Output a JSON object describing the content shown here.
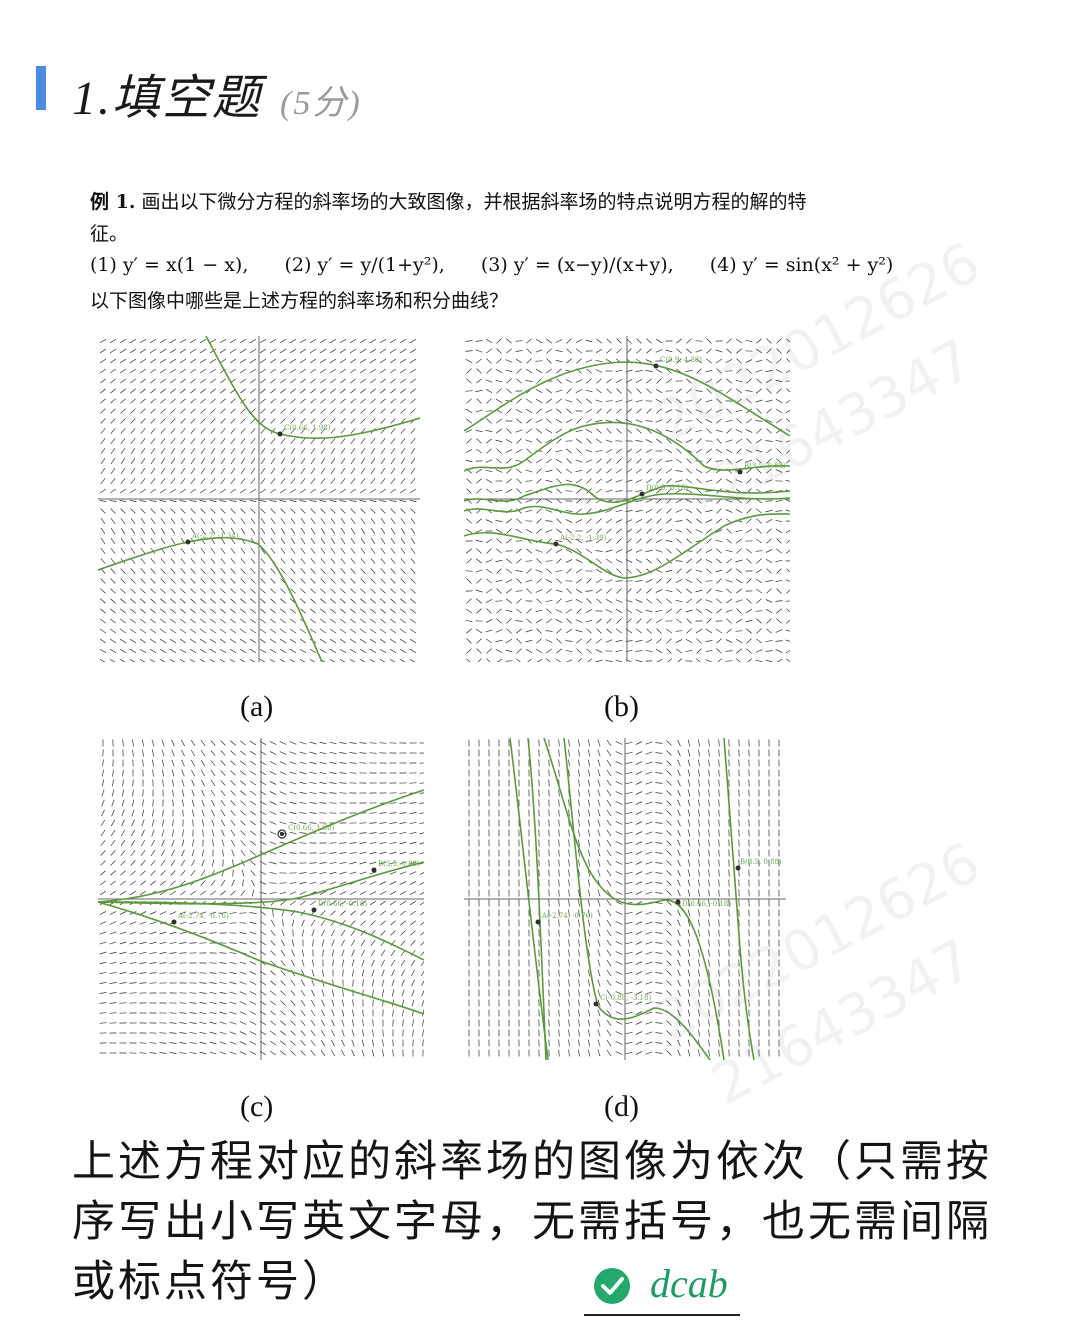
{
  "header": {
    "title": "1.填空题",
    "score": "(5分)"
  },
  "problem": {
    "label": "例 1.",
    "text": "画出以下微分方程的斜率场的大致图像，并根据斜率场的特点说明方程的解的特征。",
    "equations": [
      "(1) y′ = x(1 − x),",
      "(2) y′ = y/(1+y²),",
      "(3) y′ = (x−y)/(x+y),",
      "(4) y′ = sin(x² + y²)"
    ],
    "question": "以下图像中哪些是上述方程的斜率场和积分曲线？"
  },
  "watermarks": [
    "2022012626",
    "21643347"
  ],
  "figures": [
    {
      "caption": "(a)",
      "points": [
        "C(0.66, 1.98)",
        "A(-2.7, -1.34)"
      ]
    },
    {
      "caption": "(b)",
      "points": [
        "C(0.9, 4.38)",
        "B(3.5, 0.88)",
        "D(0.9, 0.16)",
        "A(-2.2, -1.39)"
      ]
    },
    {
      "caption": "(c)",
      "points": [
        "C(0.66, 1.98)",
        "B(3.5, 0.88)",
        "A(-2.74, -0.76)",
        "D(0.66, -0.18)"
      ]
    },
    {
      "caption": "(d)",
      "points": [
        "B(3.5, 0.88)",
        "A(-2.74, -0.76)",
        "D(0.66, -0.18)",
        "C(-0.88, -3.18)"
      ]
    }
  ],
  "answer": {
    "prompt": "上述方程对应的斜率场的图像为依次（只需按序写出小写英文字母，无需括号，也无需间隔或标点符号）",
    "value": "dcab",
    "status_icon": "check-circle-icon",
    "accent": "#23a96b"
  }
}
